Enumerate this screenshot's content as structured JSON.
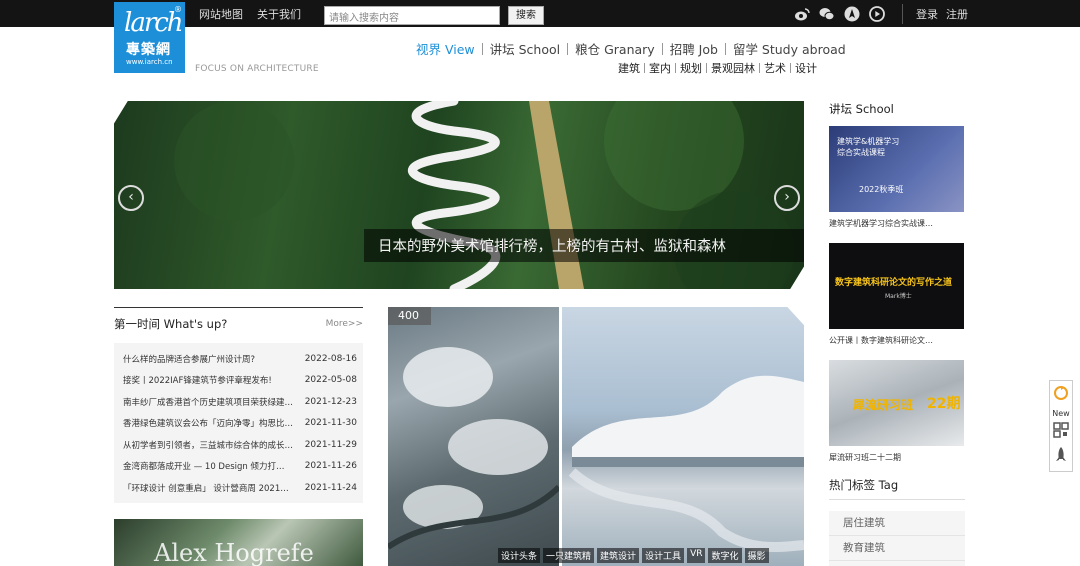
{
  "topbar": {
    "links": [
      "网站地图",
      "关于我们"
    ],
    "search_placeholder": "请输入搜索内容",
    "search_button": "搜索",
    "social_icons": [
      "weibo-icon",
      "wechat-icon",
      "lotus-icon",
      "play-icon"
    ],
    "login": "登录",
    "register": "注册"
  },
  "logo": {
    "latin": "larch",
    "cjk": "專築網",
    "url": "www.iarch.cn",
    "reg": "®"
  },
  "tagline": "FOCUS ON ARCHITECTURE",
  "main_nav": [
    "视界 View",
    "讲坛 School",
    "粮仓 Granary",
    "招聘 Job",
    "留学 Study abroad"
  ],
  "sub_nav": [
    "建筑",
    "室内",
    "规划",
    "景观园林",
    "艺术",
    "设计"
  ],
  "hero": {
    "caption": "日本的野外美术馆排行榜，上榜的有古村、监狱和森林",
    "prev": "‹",
    "next": "›"
  },
  "whats_up": {
    "title": "第一时间 What's up?",
    "more": "More>>",
    "items": [
      {
        "title": "什么样的品牌适合参展广州设计周?",
        "date": "2022-08-16"
      },
      {
        "title": "接奖丨2022IAF锋建筑节参评章程发布!",
        "date": "2022-05-08"
      },
      {
        "title": "南丰纱厂成香港首个历史建筑项目荣获绿建…",
        "date": "2021-12-23"
      },
      {
        "title": "香港绿色建筑议会公布「迈向净零」构思比…",
        "date": "2021-11-30"
      },
      {
        "title": "从初学者到引领者，三益城市综合体的成长…",
        "date": "2021-11-29"
      },
      {
        "title": "金湾商都落成开业 — 10 Design 倾力打…",
        "date": "2021-11-26"
      },
      {
        "title": "「环球设计 创意重启」 设计營商周 2021…",
        "date": "2021-11-24"
      }
    ]
  },
  "thumb_text": "Alex Hogrefe",
  "feature": {
    "badge": "400",
    "tags": [
      "设计头条",
      "一只建筑精",
      "建筑设计",
      "设计工具",
      "VR",
      "数字化",
      "摄影"
    ]
  },
  "sidebar": {
    "school_title": "讲坛 School",
    "cards": [
      {
        "caption": "建筑学机器学习综合实战课…",
        "img_title": "建筑学&机器学习 综合实战课程",
        "img_sub": "2022秋季班"
      },
      {
        "caption": "公开课丨数字建筑科研论文…",
        "img_title": "数字建筑科研论文的写作之道",
        "img_sub": "Mark博士"
      },
      {
        "caption": "犀流研习班二十二期",
        "img_title": "犀流研习班",
        "img_sub": "22期"
      }
    ],
    "tags_title": "热门标签 Tag",
    "tags": [
      "居住建筑",
      "教育建筑"
    ]
  },
  "floatbar": {
    "new_label": "New",
    "icons": [
      "refresh-icon",
      "qrcode-icon",
      "rocket-icon"
    ]
  }
}
